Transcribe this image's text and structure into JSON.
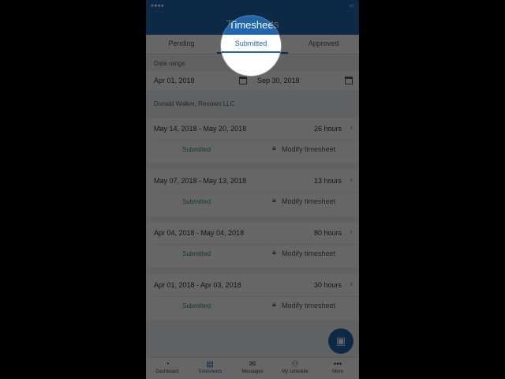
{
  "header": {
    "title": "Timesheets"
  },
  "tabs": [
    {
      "label": "Pending"
    },
    {
      "label": "Submitted"
    },
    {
      "label": "Approved"
    }
  ],
  "date_range": {
    "label": "Date range",
    "start": "Apr 01, 2018",
    "end": "Sep 30, 2018"
  },
  "owner": {
    "label": "Donald Walker, Renown LLC"
  },
  "timesheets": [
    {
      "range": "May 14, 2018 - May 20, 2018",
      "hours": "26 hours",
      "status": "Submitted",
      "action": "Modify timesheet"
    },
    {
      "range": "May 07, 2018 - May 13, 2018",
      "hours": "13 hours",
      "status": "Submitted",
      "action": "Modify timesheet"
    },
    {
      "range": "Apr 04, 2018 - May 04, 2018",
      "hours": "80 hours",
      "status": "Submitted",
      "action": "Modify timesheet"
    },
    {
      "range": "Apr 01, 2018 - Apr 03, 2018",
      "hours": "30 hours",
      "status": "Submitted",
      "action": "Modify timesheet"
    }
  ],
  "bottom_nav": [
    {
      "label": "Dashboard",
      "icon": "dashboard-icon"
    },
    {
      "label": "Timesheets",
      "icon": "timesheets-icon"
    },
    {
      "label": "Messages",
      "icon": "messages-icon"
    },
    {
      "label": "My schedule",
      "icon": "schedule-icon"
    },
    {
      "label": "More",
      "icon": "more-icon"
    }
  ],
  "colors": {
    "brand": "#1f66b0",
    "status_green": "#2d9a5b"
  }
}
